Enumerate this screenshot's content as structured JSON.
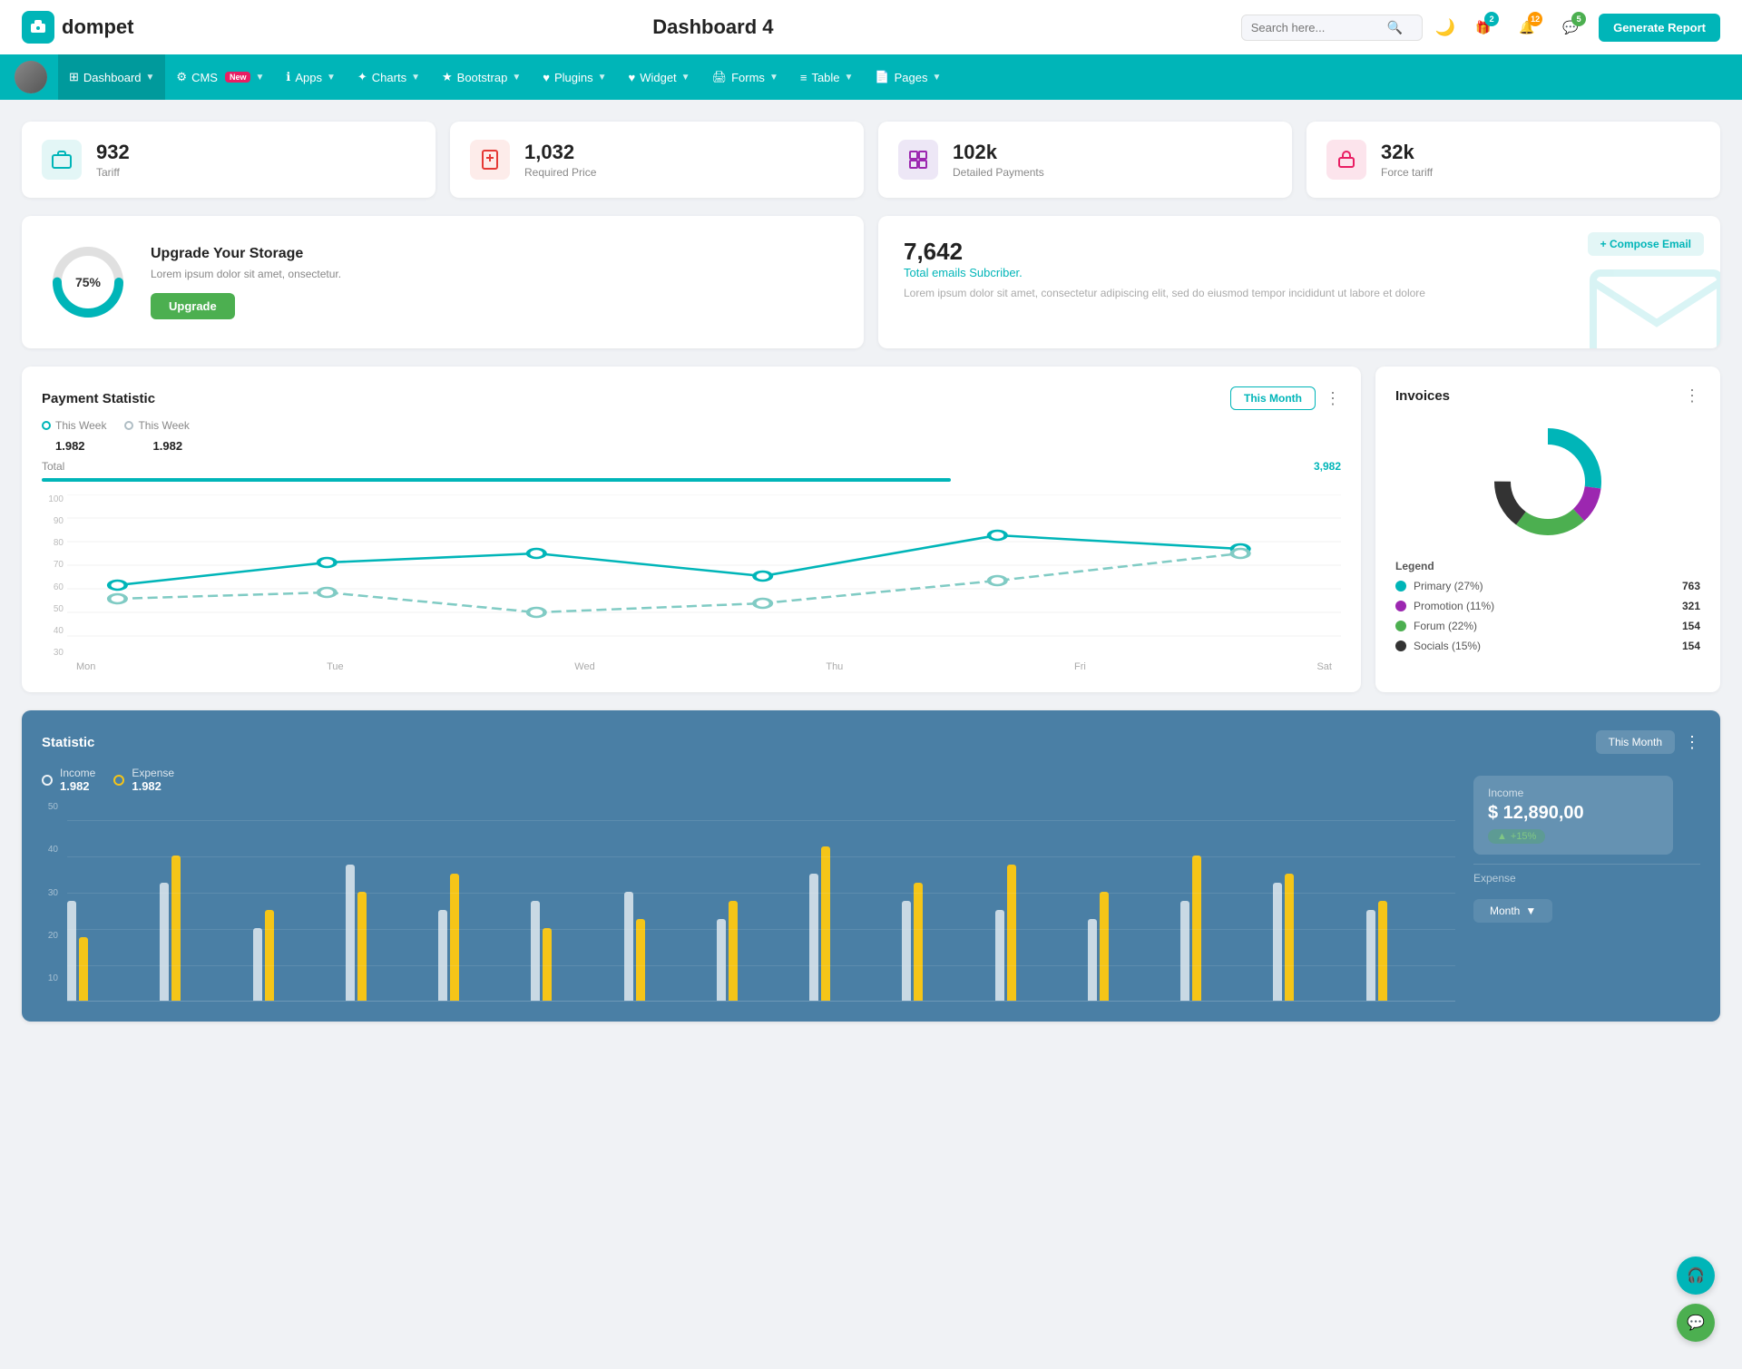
{
  "header": {
    "logo_text": "dompet",
    "title": "Dashboard 4",
    "search_placeholder": "Search here...",
    "generate_btn": "Generate Report",
    "badges": {
      "gift": "2",
      "bell": "12",
      "chat": "5"
    }
  },
  "nav": {
    "items": [
      {
        "id": "dashboard",
        "label": "Dashboard",
        "active": true,
        "has_arrow": true
      },
      {
        "id": "cms",
        "label": "CMS",
        "badge_new": true,
        "has_arrow": true
      },
      {
        "id": "apps",
        "label": "Apps",
        "has_arrow": true
      },
      {
        "id": "charts",
        "label": "Charts",
        "has_arrow": true
      },
      {
        "id": "bootstrap",
        "label": "Bootstrap",
        "has_arrow": true
      },
      {
        "id": "plugins",
        "label": "Plugins",
        "has_arrow": true
      },
      {
        "id": "widget",
        "label": "Widget",
        "has_arrow": true
      },
      {
        "id": "forms",
        "label": "Forms",
        "has_arrow": true
      },
      {
        "id": "table",
        "label": "Table",
        "has_arrow": true
      },
      {
        "id": "pages",
        "label": "Pages",
        "has_arrow": true
      }
    ]
  },
  "stat_cards": [
    {
      "id": "tariff",
      "value": "932",
      "label": "Tariff",
      "icon": "briefcase",
      "color": "blue"
    },
    {
      "id": "required-price",
      "value": "1,032",
      "label": "Required Price",
      "icon": "file-plus",
      "color": "red"
    },
    {
      "id": "detailed-payments",
      "value": "102k",
      "label": "Detailed Payments",
      "icon": "grid",
      "color": "purple"
    },
    {
      "id": "force-tariff",
      "value": "32k",
      "label": "Force tariff",
      "icon": "building",
      "color": "pink"
    }
  ],
  "upgrade_card": {
    "percentage": "75%",
    "title": "Upgrade Your Storage",
    "description": "Lorem ipsum dolor sit amet, onsectetur.",
    "btn_label": "Upgrade"
  },
  "email_card": {
    "count": "7,642",
    "subtitle": "Total emails Subcriber.",
    "description": "Lorem ipsum dolor sit amet, consectetur adipiscing elit, sed do eiusmod tempor incididunt ut labore et dolore",
    "compose_btn": "+ Compose Email"
  },
  "payment_statistic": {
    "title": "Payment Statistic",
    "filter_label": "This Month",
    "this_week_label1": "This Week",
    "this_week_val1": "1.982",
    "this_week_label2": "This Week",
    "this_week_val2": "1.982",
    "total_label": "Total",
    "total_value": "3,982",
    "x_labels": [
      "Mon",
      "Tue",
      "Wed",
      "Thu",
      "Fri",
      "Sat"
    ],
    "y_labels": [
      "100",
      "90",
      "80",
      "70",
      "60",
      "50",
      "40",
      "30"
    ],
    "line1_points": "60,140 180,100 310,85 450,120 590,60 730,80",
    "line2_points": "60,150 180,115 310,150 450,135 590,105 730,85"
  },
  "invoices": {
    "title": "Invoices",
    "donut_data": [
      {
        "label": "Primary",
        "percent": 27,
        "count": "763",
        "color": "#00b5b8"
      },
      {
        "label": "Promotion",
        "percent": 11,
        "count": "321",
        "color": "#9c27b0"
      },
      {
        "label": "Forum",
        "percent": 22,
        "count": "154",
        "color": "#4caf50"
      },
      {
        "label": "Socials",
        "percent": 15,
        "count": "154",
        "color": "#333"
      }
    ]
  },
  "statistic": {
    "title": "Statistic",
    "filter_label": "This Month",
    "y_labels": [
      "50",
      "40",
      "30",
      "20",
      "10"
    ],
    "income_label": "Income",
    "income_value": "1.982",
    "expense_label": "Expense",
    "expense_value": "1.982",
    "income_box_label": "Income",
    "income_box_value": "$ 12,890,00",
    "income_badge": "+15%",
    "expense_box_label": "Expense",
    "month_dropdown": "Month",
    "bars": [
      {
        "white": 55,
        "yellow": 35
      },
      {
        "white": 65,
        "yellow": 80
      },
      {
        "white": 40,
        "yellow": 50
      },
      {
        "white": 75,
        "yellow": 60
      },
      {
        "white": 50,
        "yellow": 70
      },
      {
        "white": 55,
        "yellow": 40
      },
      {
        "white": 60,
        "yellow": 45
      },
      {
        "white": 45,
        "yellow": 55
      },
      {
        "white": 70,
        "yellow": 85
      },
      {
        "white": 55,
        "yellow": 65
      },
      {
        "white": 50,
        "yellow": 75
      },
      {
        "white": 45,
        "yellow": 60
      },
      {
        "white": 55,
        "yellow": 80
      },
      {
        "white": 65,
        "yellow": 70
      },
      {
        "white": 50,
        "yellow": 55
      }
    ]
  }
}
